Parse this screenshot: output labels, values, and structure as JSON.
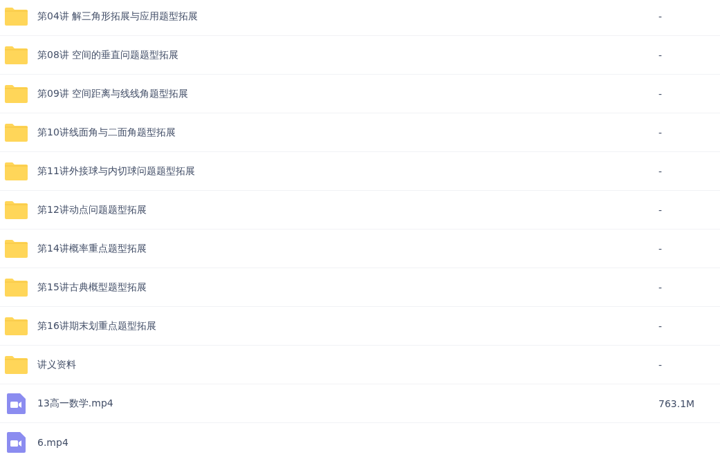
{
  "files": [
    {
      "kind": "folder",
      "name": "第04讲 解三角形拓展与应用题型拓展",
      "size": "-"
    },
    {
      "kind": "folder",
      "name": "第08讲 空间的垂直问题题型拓展",
      "size": "-"
    },
    {
      "kind": "folder",
      "name": "第09讲 空间距离与线线角题型拓展",
      "size": "-"
    },
    {
      "kind": "folder",
      "name": "第10讲线面角与二面角题型拓展",
      "size": "-"
    },
    {
      "kind": "folder",
      "name": "第11讲外接球与内切球问题题型拓展",
      "size": "-"
    },
    {
      "kind": "folder",
      "name": "第12讲动点问题题型拓展",
      "size": "-"
    },
    {
      "kind": "folder",
      "name": "第14讲概率重点题型拓展",
      "size": "-"
    },
    {
      "kind": "folder",
      "name": "第15讲古典概型题型拓展",
      "size": "-"
    },
    {
      "kind": "folder",
      "name": "第16讲期末划重点题型拓展",
      "size": "-"
    },
    {
      "kind": "folder",
      "name": "讲义资料",
      "size": "-"
    },
    {
      "kind": "video",
      "name": "13高一数学.mp4",
      "size": "763.1M"
    },
    {
      "kind": "video",
      "name": "6.mp4"
    }
  ]
}
